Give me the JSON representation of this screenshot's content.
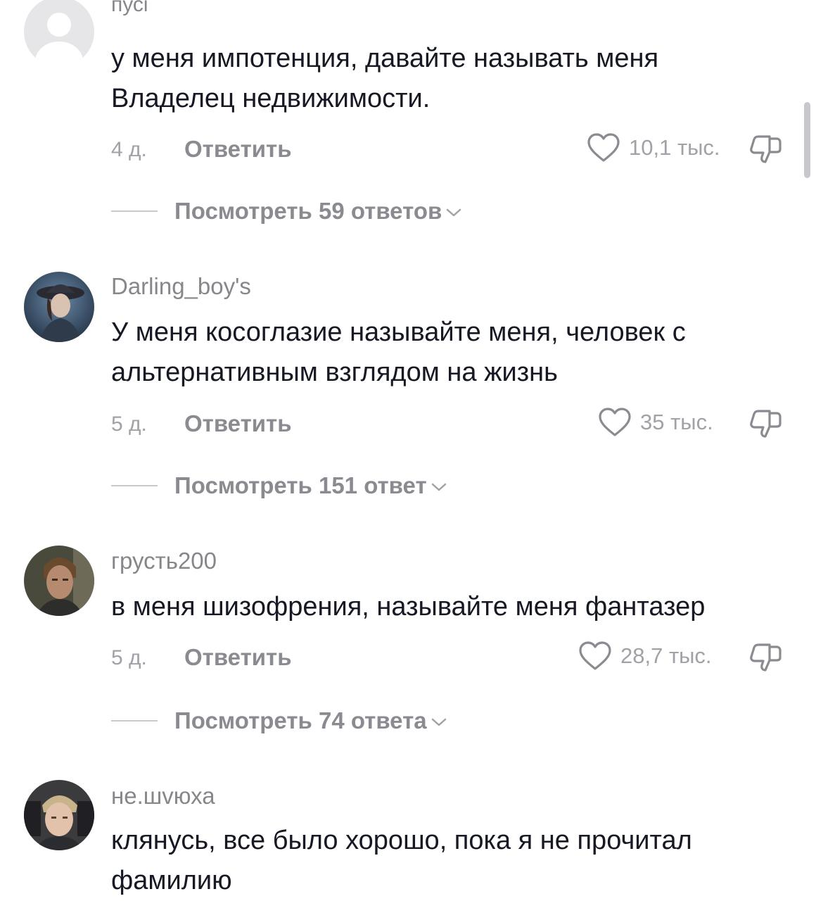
{
  "comments": [
    {
      "username": "пусі",
      "text": "у меня импотенция, давайте называть меня Владелец недвижимости.",
      "age": "4 д.",
      "reply_label": "Ответить",
      "likes": "10,1 тыс.",
      "view_replies": "Посмотреть 59 ответов"
    },
    {
      "username": "Darling_boy's",
      "text": "У меня косоглазие называйте меня, человек с альтернативным взглядом на жизнь",
      "age": "5 д.",
      "reply_label": "Ответить",
      "likes": "35 тыс.",
      "view_replies": "Посмотреть 151 ответ"
    },
    {
      "username": "грусть200",
      "text": "в меня шизофрения, называйте меня фантазер",
      "age": "5 д.",
      "reply_label": "Ответить",
      "likes": "28,7 тыс.",
      "view_replies": "Посмотреть 74 ответа"
    },
    {
      "username": "не.шvюха",
      "text": "клянусь, все было хорошо, пока я не прочитал фамилию"
    }
  ],
  "icons": {
    "like": "heart-outline-icon",
    "dislike": "thumbs-down-icon",
    "expand": "chevron-down-icon"
  },
  "colors": {
    "text": "#161823",
    "secondary": "#86878b",
    "icon": "#8a8b91"
  }
}
